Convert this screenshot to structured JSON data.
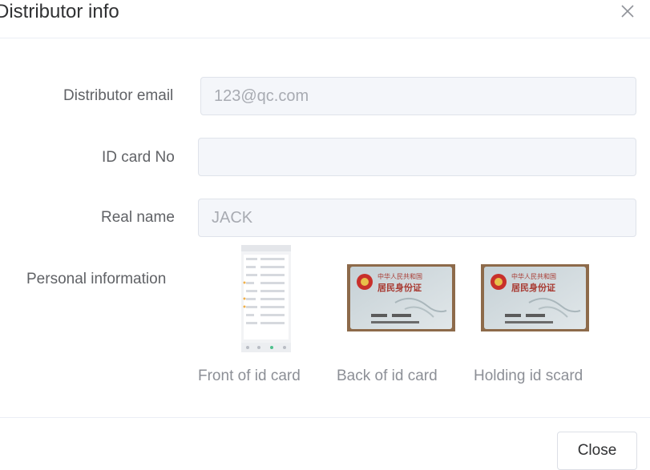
{
  "dialog": {
    "title": "Distributor info"
  },
  "form": {
    "email": {
      "label": "Distributor email",
      "value": "123@qc.com"
    },
    "id_card": {
      "label": "ID card No",
      "value": ""
    },
    "real_name": {
      "label": "Real name",
      "value": "JACK"
    },
    "personal_info": {
      "label": "Personal information",
      "images": [
        {
          "caption": "Front of id card",
          "icon": "phone-screenshot-thumbnail"
        },
        {
          "caption": "Back of id card",
          "icon": "id-card-thumbnail"
        },
        {
          "caption": "Holding id scard",
          "icon": "id-card-thumbnail"
        }
      ]
    }
  },
  "footer": {
    "close_label": "Close"
  },
  "id_card_image_text": {
    "line1": "中华人民共和国",
    "line2": "居民身份证"
  },
  "colors": {
    "border": "#dcdfe6",
    "field_bg": "#f4f6fa",
    "text": "#606266",
    "placeholder": "#a8abb2"
  }
}
